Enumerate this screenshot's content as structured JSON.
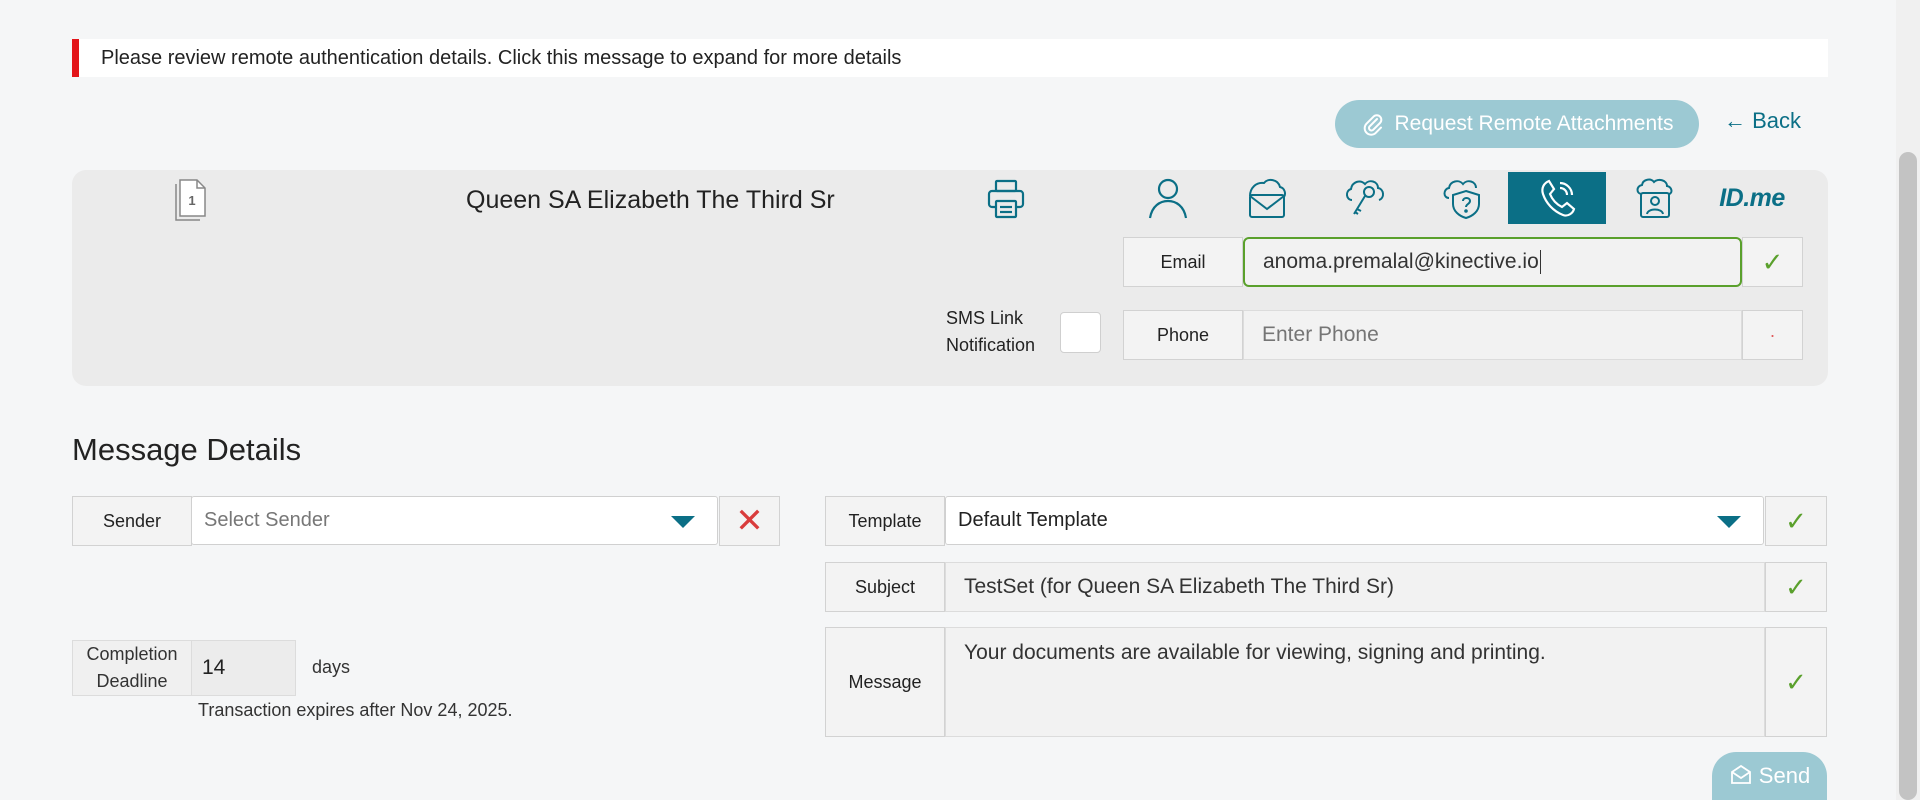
{
  "alert": {
    "text": "Please review remote authentication details. Click this message to expand for more details",
    "color": "#e3151a"
  },
  "actions": {
    "request_remote_attachments": "Request Remote Attachments",
    "back": "← Back"
  },
  "recipient": {
    "document_count": "1",
    "name": "Queen SA Elizabeth The Third Sr",
    "auth_methods": [
      {
        "icon": "person-icon",
        "active": false
      },
      {
        "icon": "email-icon",
        "active": false
      },
      {
        "icon": "cloud-key-icon",
        "active": false
      },
      {
        "icon": "shield-question-icon",
        "active": false
      },
      {
        "icon": "phone-icon",
        "active": true
      },
      {
        "icon": "id-card-icon",
        "active": false
      },
      {
        "icon": "idme-logo",
        "label": "ID.me",
        "active": false
      }
    ],
    "email": {
      "label": "Email",
      "value": "anoma.premalal@kinective.io"
    },
    "sms": {
      "label_line1": "SMS Link",
      "label_line2": "Notification",
      "checked": false
    },
    "phone": {
      "label": "Phone",
      "value": "",
      "placeholder": "Enter Phone"
    }
  },
  "message_details": {
    "title": "Message Details",
    "sender": {
      "label": "Sender",
      "value": "",
      "placeholder": "Select Sender"
    },
    "completion": {
      "label_line1": "Completion",
      "label_line2": "Deadline",
      "value": "14",
      "unit": "days",
      "expires_note": "Transaction expires after Nov 24, 2025."
    },
    "template": {
      "label": "Template",
      "value": "Default Template"
    },
    "subject": {
      "label": "Subject",
      "value": "TestSet (for Queen SA Elizabeth The Third Sr)"
    },
    "message": {
      "label": "Message",
      "value": "Your documents are available for viewing, signing and printing."
    },
    "send": "Send"
  },
  "colors": {
    "accent": "#0b6f86",
    "button_disabled": "#9cc9d3",
    "check": "#5aa02c",
    "error": "#d93c3c",
    "email_focus_border": "#5aa02c"
  }
}
